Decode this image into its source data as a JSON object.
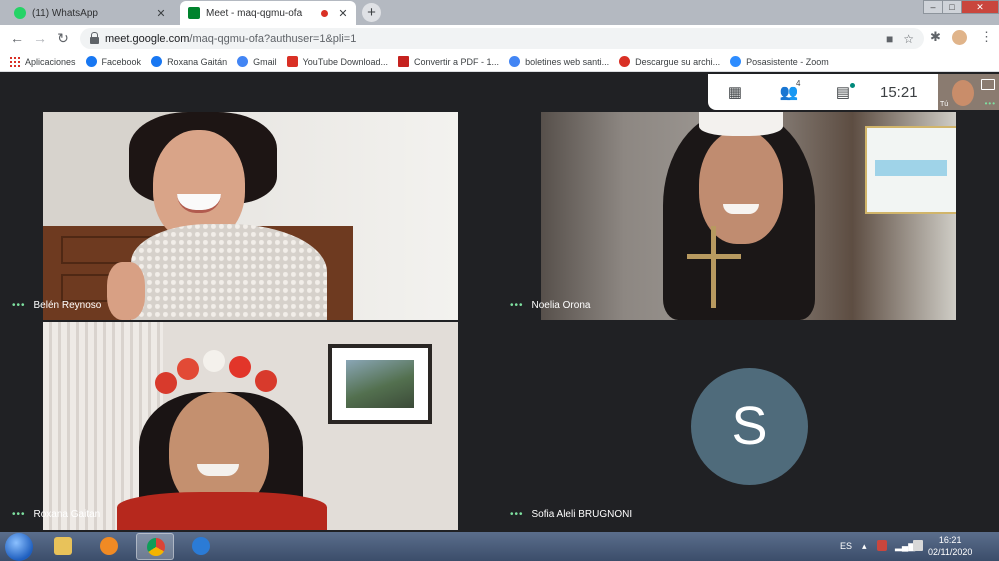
{
  "browser": {
    "tabs": [
      {
        "title": "(11) WhatsApp",
        "active": false
      },
      {
        "title": "Meet - maq-qgmu-ofa",
        "active": true
      }
    ],
    "url_host": "meet.google.com",
    "url_path": "/maq-qgmu-ofa?authuser=1&pli=1"
  },
  "bookmarks": [
    {
      "label": "Aplicaciones",
      "icon": "apps-grid-icon"
    },
    {
      "label": "Facebook",
      "icon": "facebook-icon",
      "color": "#1877f2"
    },
    {
      "label": "Roxana Gaitán",
      "icon": "facebook-icon",
      "color": "#1877f2"
    },
    {
      "label": "Gmail",
      "icon": "google-icon",
      "color": "#4285f4"
    },
    {
      "label": "YouTube Download...",
      "icon": "download-icon",
      "color": "#d93025"
    },
    {
      "label": "Convertir a PDF - 1...",
      "icon": "pdf-icon",
      "color": "#c5221f"
    },
    {
      "label": "boletines web santi...",
      "icon": "google-icon",
      "color": "#4285f4"
    },
    {
      "label": "Descargue su archi...",
      "icon": "blocked-icon",
      "color": "#d93025"
    },
    {
      "label": "Posasistente - Zoom",
      "icon": "zoom-icon",
      "color": "#2d8cff"
    }
  ],
  "meet": {
    "people_count": "4",
    "time": "15:21",
    "self_label": "Tú",
    "participants": [
      {
        "name": "Belén Reynoso"
      },
      {
        "name": "Noelia Orona"
      },
      {
        "name": "Roxana Gaitan"
      },
      {
        "name": "Sofia Aleli BRUGNONI",
        "initial": "S"
      }
    ]
  },
  "taskbar": {
    "language": "ES",
    "clock_time": "16:21",
    "clock_date": "02/11/2020"
  },
  "colors": {
    "meet_background": "#202124",
    "avatar": "#4f6b7b",
    "more_dots": "#7ee0a0"
  }
}
